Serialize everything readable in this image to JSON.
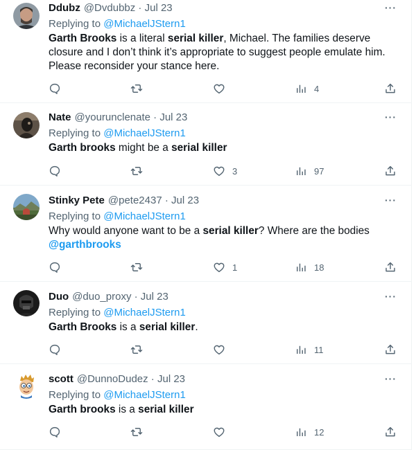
{
  "tweets": [
    {
      "name": "Ddubz",
      "handle": "@Dvdubbz",
      "date": "Jul 23",
      "replying_prefix": "Replying to ",
      "replying_to": "@MichaelJStern1",
      "text_segments": [
        {
          "text": "Garth Brooks",
          "bold": true
        },
        {
          "text": " is a literal ",
          "bold": false
        },
        {
          "text": "serial killer",
          "bold": true
        },
        {
          "text": ", Michael. The families deserve closure and I don’t think it’s appropriate to suggest people emulate him.",
          "bold": false
        },
        {
          "text": "\nPlease reconsider your stance here.",
          "bold": false
        }
      ],
      "replies": "",
      "retweets": "",
      "likes": "",
      "views": "4",
      "avatar": "man-gray-background"
    },
    {
      "name": "Nate",
      "handle": "@yourunclenate",
      "date": "Jul 23",
      "replying_prefix": "Replying to ",
      "replying_to": "@MichaelJStern1",
      "text_segments": [
        {
          "text": "Garth brooks",
          "bold": true
        },
        {
          "text": " might be a ",
          "bold": false
        },
        {
          "text": "serial killer",
          "bold": true
        }
      ],
      "replies": "",
      "retweets": "",
      "likes": "3",
      "views": "97",
      "avatar": "dark-figure"
    },
    {
      "name": "Stinky Pete",
      "handle": "@pete2437",
      "date": "Jul 23",
      "replying_prefix": "Replying to ",
      "replying_to": "@MichaelJStern1",
      "text_segments": [
        {
          "text": "Why would anyone want to be a ",
          "bold": false
        },
        {
          "text": "serial killer",
          "bold": true
        },
        {
          "text": "? Where are the bodies",
          "bold": false
        },
        {
          "text": "\n",
          "bold": false
        },
        {
          "text": "@garthbrooks",
          "bold": true,
          "link": true
        }
      ],
      "replies": "",
      "retweets": "",
      "likes": "1",
      "views": "18",
      "avatar": "landscape"
    },
    {
      "name": "Duo",
      "handle": "@duo_proxy",
      "date": "Jul 23",
      "replying_prefix": "Replying to ",
      "replying_to": "@MichaelJStern1",
      "text_segments": [
        {
          "text": "Garth Brooks",
          "bold": true
        },
        {
          "text": " is a ",
          "bold": false
        },
        {
          "text": "serial killer",
          "bold": true
        },
        {
          "text": ".",
          "bold": false
        }
      ],
      "replies": "",
      "retweets": "",
      "likes": "",
      "views": "11",
      "avatar": "dark-helmet"
    },
    {
      "name": "scott",
      "handle": "@DunnoDudez",
      "date": "Jul 23",
      "replying_prefix": "Replying to ",
      "replying_to": "@MichaelJStern1",
      "text_segments": [
        {
          "text": "Garth brooks",
          "bold": true
        },
        {
          "text": " is a ",
          "bold": false
        },
        {
          "text": "serial killer",
          "bold": true
        }
      ],
      "replies": "",
      "retweets": "",
      "likes": "",
      "views": "12",
      "avatar": "cartoon-face"
    }
  ],
  "icons": {
    "more": "more-dots-icon",
    "reply": "reply-icon",
    "retweet": "retweet-icon",
    "like": "heart-icon",
    "views": "views-icon",
    "share": "share-icon"
  },
  "colors": {
    "text": "#0f1419",
    "secondary": "#536471",
    "link": "#1d9bf0",
    "divider": "#eff3f4"
  }
}
